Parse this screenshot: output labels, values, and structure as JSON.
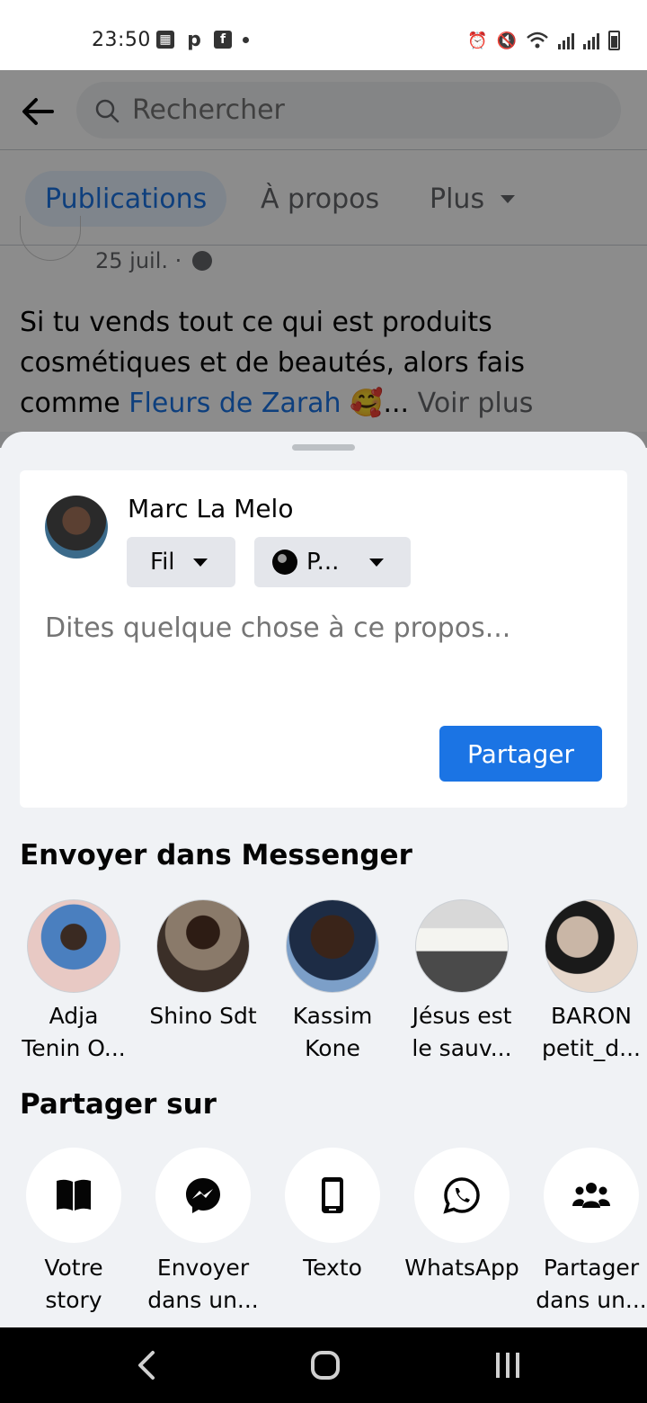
{
  "status_bar": {
    "time": "23:50",
    "left_icons": [
      "gallery-icon",
      "pinterest-icon",
      "facebook-icon",
      "dot-icon"
    ],
    "right_icons": [
      "alarm-icon",
      "mute-icon",
      "wifi-icon",
      "signal-icon",
      "signal-icon",
      "battery-icon"
    ]
  },
  "background_page": {
    "search": {
      "placeholder": "Rechercher"
    },
    "tabs": [
      {
        "label": "Publications",
        "active": true
      },
      {
        "label": "À propos"
      },
      {
        "label": "Plus"
      }
    ],
    "post": {
      "date": "25 juil. ·",
      "text_before": "Si tu vends tout ce qui est produits cosmétiques et de beautés, alors fais comme ",
      "link_text": "Fleurs de Zarah",
      "emoji": "🥰",
      "ellipsis": "...",
      "see_more": "Voir plus"
    }
  },
  "composer": {
    "user_name": "Marc La Melo",
    "audience_feed": "Fil",
    "audience_privacy": "P...",
    "input_placeholder": "Dites quelque chose à ce propos...",
    "share_button": "Partager"
  },
  "messenger": {
    "title": "Envoyer dans Messenger",
    "contacts": [
      {
        "name_line1": "Adja",
        "name_line2": "Tenin O..."
      },
      {
        "name_line1": "Shino Sdt",
        "name_line2": ""
      },
      {
        "name_line1": "Kassim",
        "name_line2": "Kone"
      },
      {
        "name_line1": "Jésus est",
        "name_line2": "le sauv..."
      },
      {
        "name_line1": "BARON",
        "name_line2": "petit_d..."
      }
    ]
  },
  "share_on": {
    "title": "Partager sur",
    "targets": [
      {
        "icon": "book-icon",
        "line1": "Votre",
        "line2": "story"
      },
      {
        "icon": "messenger-icon",
        "line1": "Envoyer",
        "line2": "dans un..."
      },
      {
        "icon": "phone-icon",
        "line1": "Texto",
        "line2": ""
      },
      {
        "icon": "whatsapp-icon",
        "line1": "WhatsApp",
        "line2": ""
      },
      {
        "icon": "group-icon",
        "line1": "Partager",
        "line2": "dans un..."
      }
    ]
  },
  "colors": {
    "accent": "#1b74e4",
    "sheet_bg": "#f0f2f5",
    "text_primary": "#050505",
    "text_secondary": "#65676b"
  }
}
